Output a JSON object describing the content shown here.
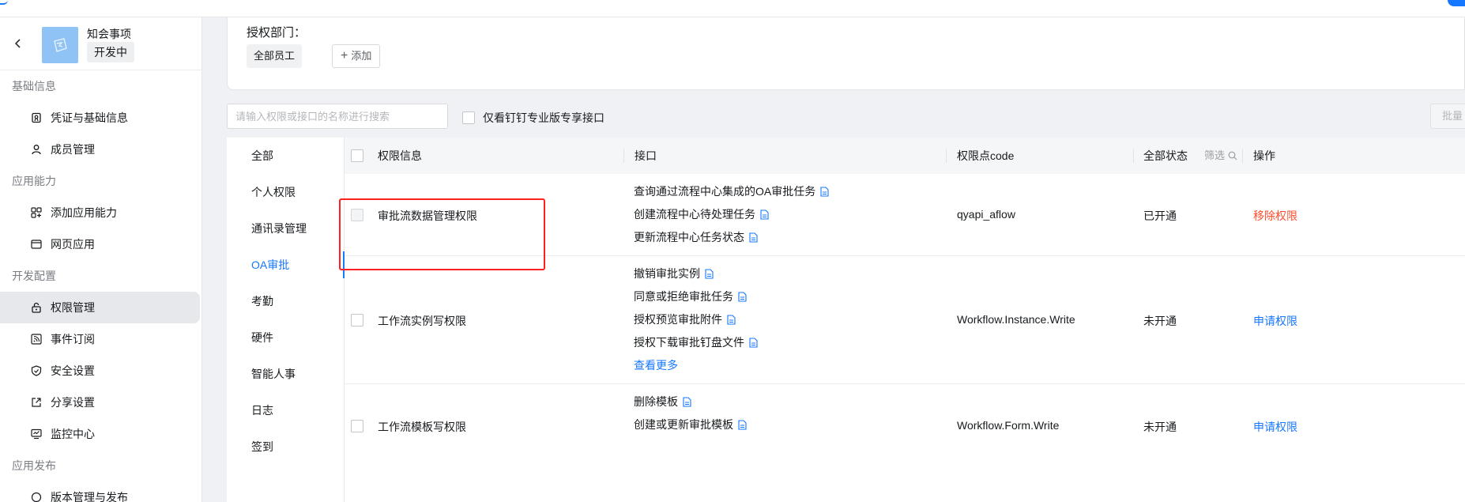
{
  "sidebar": {
    "app_name": "知会事项",
    "app_status": "开发中",
    "groups": [
      {
        "title": "基础信息",
        "items": [
          {
            "label": "凭证与基础信息",
            "icon": "credential-icon"
          },
          {
            "label": "成员管理",
            "icon": "user-icon"
          }
        ]
      },
      {
        "title": "应用能力",
        "items": [
          {
            "label": "添加应用能力",
            "icon": "apps-add-icon"
          },
          {
            "label": "网页应用",
            "icon": "webpage-icon"
          }
        ]
      },
      {
        "title": "开发配置",
        "items": [
          {
            "label": "权限管理",
            "icon": "lock-icon",
            "active": true
          },
          {
            "label": "事件订阅",
            "icon": "rss-icon"
          },
          {
            "label": "安全设置",
            "icon": "shield-icon"
          },
          {
            "label": "分享设置",
            "icon": "share-icon"
          },
          {
            "label": "监控中心",
            "icon": "monitor-icon"
          }
        ]
      },
      {
        "title": "应用发布",
        "items": [
          {
            "label": "版本管理与发布",
            "icon": "version-icon"
          }
        ]
      }
    ]
  },
  "auth": {
    "label": "授权部门：",
    "tag": "全部员工",
    "add_label": "添加"
  },
  "toolbar": {
    "search_placeholder": "请输入权限或接口的名称进行搜索",
    "only_checkbox_label": "仅看钉钉专业版专享接口",
    "batch_label": "批量"
  },
  "categories": [
    "全部",
    "个人权限",
    "通讯录管理",
    "OA审批",
    "考勤",
    "硬件",
    "智能人事",
    "日志",
    "签到"
  ],
  "active_category": "OA审批",
  "table": {
    "headers": {
      "info": "权限信息",
      "api": "接口",
      "code": "权限点code",
      "status": "全部状态",
      "filter": "筛选",
      "op": "操作"
    },
    "rows": [
      {
        "name": "审批流数据管理权限",
        "apis": [
          "查询通过流程中心集成的OA审批任务",
          "创建流程中心待处理任务",
          "更新流程中心任务状态"
        ],
        "code": "qyapi_aflow",
        "status": "已开通",
        "op": "移除权限",
        "op_type": "remove"
      },
      {
        "name": "工作流实例写权限",
        "apis": [
          "撤销审批实例",
          "同意或拒绝审批任务",
          "授权预览审批附件",
          "授权下载审批钉盘文件"
        ],
        "more": "查看更多",
        "code": "Workflow.Instance.Write",
        "status": "未开通",
        "op": "申请权限",
        "op_type": "apply"
      },
      {
        "name": "工作流模板写权限",
        "apis": [
          "删除模板",
          "创建或更新审批模板"
        ],
        "code": "Workflow.Form.Write",
        "status": "未开通",
        "op": "申请权限",
        "op_type": "apply"
      }
    ]
  },
  "colors": {
    "accent": "#1677ff",
    "danger": "#ff4d2e",
    "highlight_box": "#ff2020"
  }
}
